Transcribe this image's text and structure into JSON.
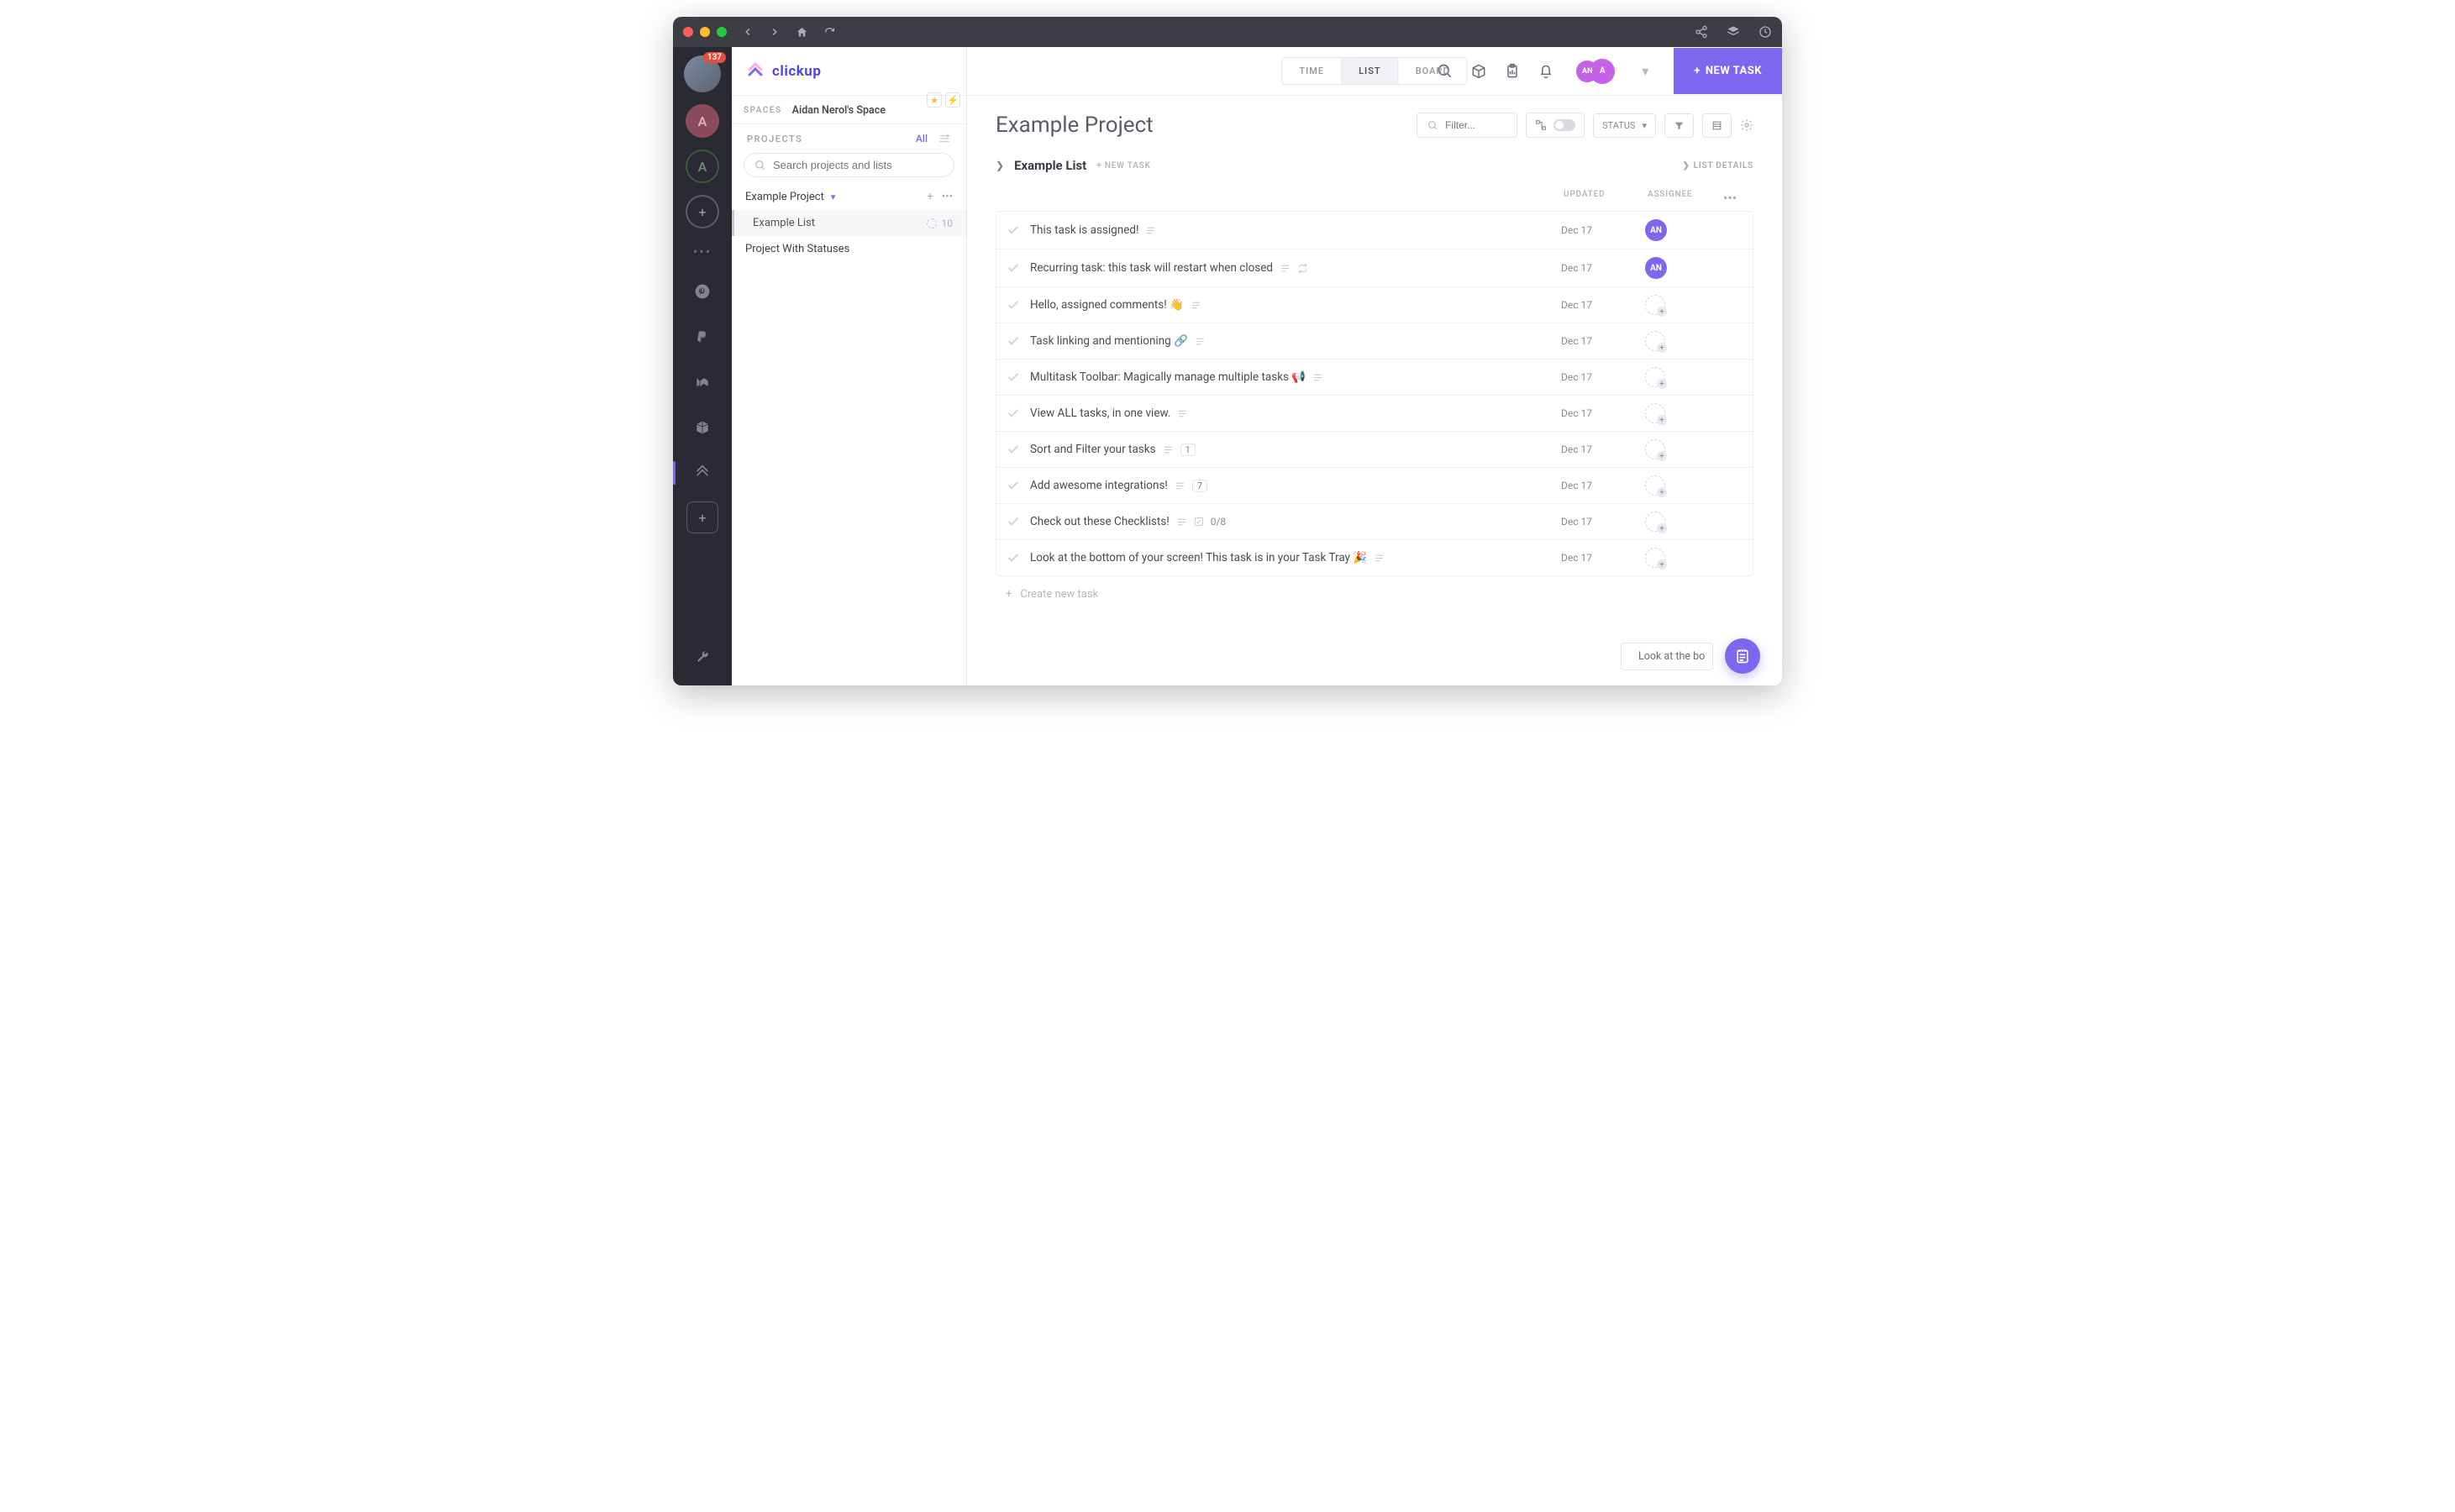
{
  "titlebar": {
    "badge_count": "137"
  },
  "rail": {
    "ws1": "A",
    "ws2": "A"
  },
  "logo": {
    "text": "clickup"
  },
  "sidebar": {
    "spaces_label": "SPACES",
    "space_name": "Aidan Nerol's Space",
    "projects_label": "PROJECTS",
    "all_link": "All",
    "search_placeholder": "Search projects and lists",
    "project1": "Example Project",
    "list1": "Example List",
    "list1_count": "10",
    "project2": "Project With Statuses"
  },
  "views": {
    "time": "TIME",
    "list": "LIST",
    "board": "BOARD"
  },
  "user": {
    "initials_small": "AN",
    "initials_large": "A"
  },
  "newtask": "NEW TASK",
  "header": {
    "title": "Example Project",
    "filter_placeholder": "Filter...",
    "status_label": "STATUS"
  },
  "list": {
    "title": "Example List",
    "new_task": "+ NEW TASK",
    "details": "LIST DETAILS"
  },
  "cols": {
    "updated": "UPDATED",
    "assignee": "ASSIGNEE"
  },
  "tasks": [
    {
      "name": "This task is assigned!",
      "date": "Dec 17",
      "assignee": "AN",
      "icons": [
        "desc"
      ]
    },
    {
      "name": "Recurring task: this task will restart when closed",
      "date": "Dec 17",
      "assignee": "AN",
      "icons": [
        "desc",
        "recur"
      ]
    },
    {
      "name": "Hello, assigned comments! 👋",
      "date": "Dec 17",
      "assignee": null,
      "icons": [
        "desc"
      ]
    },
    {
      "name": "Task linking and mentioning 🔗",
      "date": "Dec 17",
      "assignee": null,
      "icons": [
        "desc"
      ]
    },
    {
      "name": "Multitask Toolbar: Magically manage multiple tasks 📢",
      "date": "Dec 17",
      "assignee": null,
      "icons": [
        "desc"
      ]
    },
    {
      "name": "View ALL tasks, in one view.",
      "date": "Dec 17",
      "assignee": null,
      "icons": [
        "desc"
      ]
    },
    {
      "name": "Sort and Filter your tasks",
      "date": "Dec 17",
      "assignee": null,
      "icons": [
        "desc"
      ],
      "badge": "1"
    },
    {
      "name": "Add awesome integrations!",
      "date": "Dec 17",
      "assignee": null,
      "icons": [
        "desc"
      ],
      "badge": "7"
    },
    {
      "name": "Check out these Checklists!",
      "date": "Dec 17",
      "assignee": null,
      "icons": [
        "desc"
      ],
      "checklist": "0/8"
    },
    {
      "name": "Look at the bottom of your screen! This task is in your Task Tray 🎉",
      "date": "Dec 17",
      "assignee": null,
      "icons": [
        "desc"
      ]
    }
  ],
  "create_new": "Create new task",
  "tray_chip": "Look at the bo"
}
